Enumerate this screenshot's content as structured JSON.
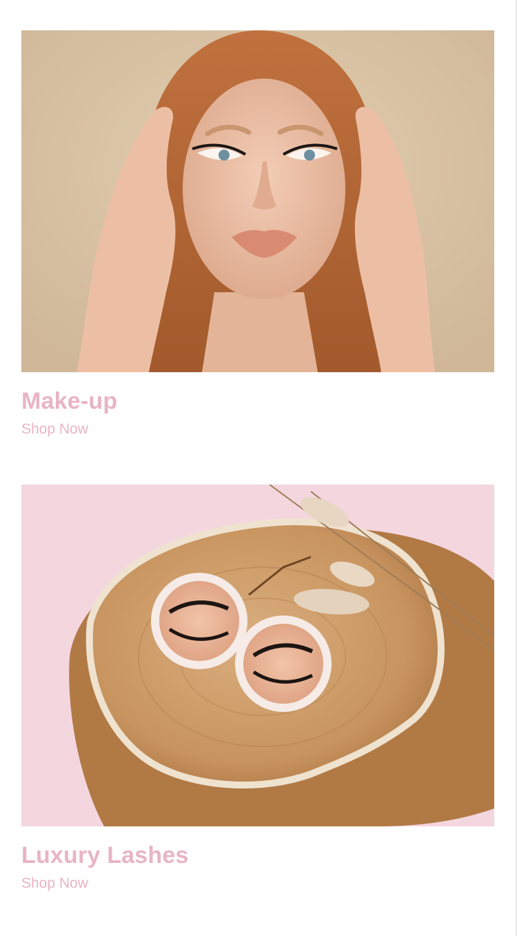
{
  "categories": [
    {
      "title": "Make-up",
      "link_label": "Shop Now",
      "image_subject": "woman-portrait-photo"
    },
    {
      "title": "Luxury Lashes",
      "link_label": "Shop Now",
      "image_subject": "lash-cases-on-wood-photo"
    }
  ],
  "colors": {
    "accent": "#e8b4c6",
    "portrait_background": "#d8c2a3",
    "lashes_background": "#f4d6df"
  }
}
